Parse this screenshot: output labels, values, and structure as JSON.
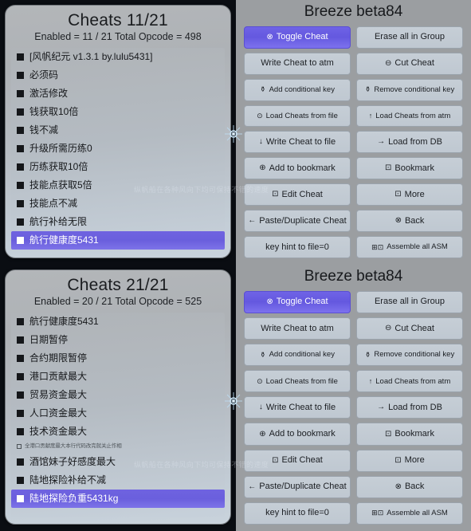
{
  "watermark_text": "纵帆船在各种风向下均可保持不错的速度",
  "panels": {
    "top_left": {
      "title": "Cheats 11/21",
      "subtitle": "Enabled = 11 / 21  Total Opcode = 498",
      "rows": [
        {
          "label": "[风帆纪元 v1.3.1 by.lulu5431]",
          "selected": false,
          "note": false
        },
        {
          "label": "必须码",
          "selected": false,
          "note": false
        },
        {
          "label": "激活修改",
          "selected": false,
          "note": false
        },
        {
          "label": "钱获取10倍",
          "selected": false,
          "note": false
        },
        {
          "label": "钱不减",
          "selected": false,
          "note": false
        },
        {
          "label": "升级所需历练0",
          "selected": false,
          "note": false
        },
        {
          "label": "历练获取10倍",
          "selected": false,
          "note": false
        },
        {
          "label": "技能点获取5倍",
          "selected": false,
          "note": false
        },
        {
          "label": "技能点不减",
          "selected": false,
          "note": false
        },
        {
          "label": "航行补给无限",
          "selected": false,
          "note": false
        },
        {
          "label": "航行健康度5431",
          "selected": true,
          "note": false
        }
      ]
    },
    "bottom_left": {
      "title": "Cheats 21/21",
      "subtitle": "Enabled = 20 / 21  Total Opcode = 525",
      "rows": [
        {
          "label": "航行健康度5431",
          "selected": false,
          "note": false
        },
        {
          "label": "日期暂停",
          "selected": false,
          "note": false
        },
        {
          "label": "合约期限暂停",
          "selected": false,
          "note": false
        },
        {
          "label": "港口贡献最大",
          "selected": false,
          "note": false
        },
        {
          "label": "贸易资金最大",
          "selected": false,
          "note": false
        },
        {
          "label": "人口资金最大",
          "selected": false,
          "note": false
        },
        {
          "label": "技术资金最大",
          "selected": false,
          "note": false
        },
        {
          "label": "全港口贡献度最大本行代码改完就关止作相",
          "selected": false,
          "note": true
        },
        {
          "label": "酒馆妹子好感度最大",
          "selected": false,
          "note": false
        },
        {
          "label": "陆地探险补给不减",
          "selected": false,
          "note": false
        },
        {
          "label": "陆地探险负重5431kg",
          "selected": true,
          "note": false
        }
      ]
    },
    "top_right": {
      "title": "Breeze beta84",
      "buttons": [
        {
          "icon": "⊗",
          "icon_name": "toggle-icon",
          "label": "Toggle Cheat",
          "primary": true,
          "small": false
        },
        {
          "icon": "",
          "icon_name": "",
          "label": "Erase all in Group",
          "primary": false,
          "small": false
        },
        {
          "icon": "",
          "icon_name": "",
          "label": "Write Cheat to atm",
          "primary": false,
          "small": false
        },
        {
          "icon": "⊖",
          "icon_name": "minus-circle-icon",
          "label": "Cut Cheat",
          "primary": false,
          "small": false
        },
        {
          "icon": "⚱",
          "icon_name": "key-icon",
          "label": "Add conditional key",
          "primary": false,
          "small": true
        },
        {
          "icon": "⚱",
          "icon_name": "key-remove-icon",
          "label": "Remove conditional key",
          "primary": false,
          "small": true
        },
        {
          "icon": "⊙",
          "icon_name": "clock-icon",
          "label": "Load Cheats from file",
          "primary": false,
          "small": true
        },
        {
          "icon": "↑",
          "icon_name": "arrow-up-icon",
          "label": "Load Cheats from atm",
          "primary": false,
          "small": true
        },
        {
          "icon": "↓",
          "icon_name": "arrow-down-icon",
          "label": "Write Cheat to file",
          "primary": false,
          "small": false
        },
        {
          "icon": "→",
          "icon_name": "arrow-right-icon",
          "label": "Load from DB",
          "primary": false,
          "small": false
        },
        {
          "icon": "⊕",
          "icon_name": "plus-circle-icon",
          "label": "Add to bookmark",
          "primary": false,
          "small": false
        },
        {
          "icon": "⊡",
          "icon_name": "bookmark-icon",
          "label": "Bookmark",
          "primary": false,
          "small": false
        },
        {
          "icon": "⊡",
          "icon_name": "edit-icon",
          "label": "Edit Cheat",
          "primary": false,
          "small": false
        },
        {
          "icon": "⊡",
          "icon_name": "more-icon",
          "label": "More",
          "primary": false,
          "small": false
        },
        {
          "icon": "←",
          "icon_name": "arrow-left-icon",
          "label": "Paste/Duplicate Cheat",
          "primary": false,
          "small": false
        },
        {
          "icon": "⊗",
          "icon_name": "back-icon",
          "label": "Back",
          "primary": false,
          "small": false
        },
        {
          "icon": "",
          "icon_name": "",
          "label": "key hint to file=0",
          "primary": false,
          "small": false
        },
        {
          "icon": "⊞⊡",
          "icon_name": "assemble-icon",
          "label": "Assemble all ASM",
          "primary": false,
          "small": true
        }
      ]
    },
    "bottom_right": {
      "title": "Breeze beta84",
      "buttons": [
        {
          "icon": "⊗",
          "icon_name": "toggle-icon",
          "label": "Toggle Cheat",
          "primary": true,
          "small": false
        },
        {
          "icon": "",
          "icon_name": "",
          "label": "Erase all in Group",
          "primary": false,
          "small": false
        },
        {
          "icon": "",
          "icon_name": "",
          "label": "Write Cheat to atm",
          "primary": false,
          "small": false
        },
        {
          "icon": "⊖",
          "icon_name": "minus-circle-icon",
          "label": "Cut Cheat",
          "primary": false,
          "small": false
        },
        {
          "icon": "⚱",
          "icon_name": "key-icon",
          "label": "Add conditional key",
          "primary": false,
          "small": true
        },
        {
          "icon": "⚱",
          "icon_name": "key-remove-icon",
          "label": "Remove conditional key",
          "primary": false,
          "small": true
        },
        {
          "icon": "⊙",
          "icon_name": "clock-icon",
          "label": "Load Cheats from file",
          "primary": false,
          "small": true
        },
        {
          "icon": "↑",
          "icon_name": "arrow-up-icon",
          "label": "Load Cheats from atm",
          "primary": false,
          "small": true
        },
        {
          "icon": "↓",
          "icon_name": "arrow-down-icon",
          "label": "Write Cheat to file",
          "primary": false,
          "small": false
        },
        {
          "icon": "→",
          "icon_name": "arrow-right-icon",
          "label": "Load from DB",
          "primary": false,
          "small": false
        },
        {
          "icon": "⊕",
          "icon_name": "plus-circle-icon",
          "label": "Add to bookmark",
          "primary": false,
          "small": false
        },
        {
          "icon": "⊡",
          "icon_name": "bookmark-icon",
          "label": "Bookmark",
          "primary": false,
          "small": false
        },
        {
          "icon": "⊡",
          "icon_name": "edit-icon",
          "label": "Edit Cheat",
          "primary": false,
          "small": false
        },
        {
          "icon": "⊡",
          "icon_name": "more-icon",
          "label": "More",
          "primary": false,
          "small": false
        },
        {
          "icon": "←",
          "icon_name": "arrow-left-icon",
          "label": "Paste/Duplicate Cheat",
          "primary": false,
          "small": false
        },
        {
          "icon": "⊗",
          "icon_name": "back-icon",
          "label": "Back",
          "primary": false,
          "small": false
        },
        {
          "icon": "",
          "icon_name": "",
          "label": "key hint to file=0",
          "primary": false,
          "small": false
        },
        {
          "icon": "⊞⊡",
          "icon_name": "assemble-icon",
          "label": "Assemble all ASM",
          "primary": false,
          "small": true
        }
      ]
    }
  },
  "colors": {
    "accent_purple": "#6f63e6",
    "panel_grey": "#b3b6b9",
    "button_face": "#c6ced6",
    "breeze_header": "#9b9ea1"
  }
}
